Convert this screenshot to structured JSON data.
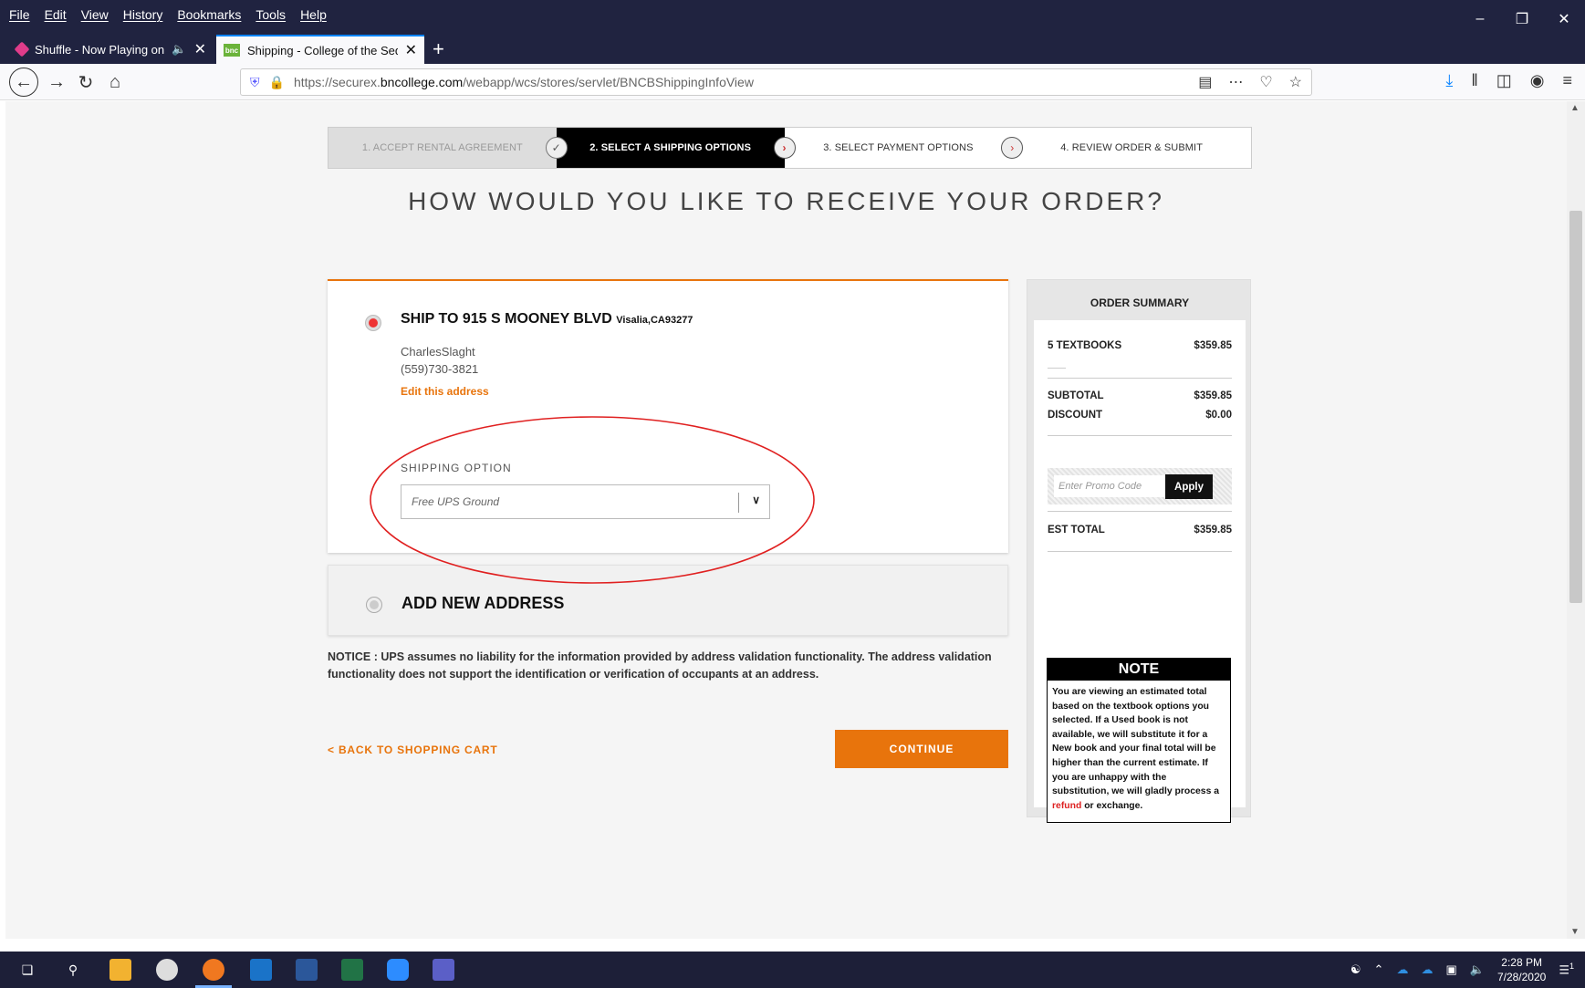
{
  "browser": {
    "menu": [
      "File",
      "Edit",
      "View",
      "History",
      "Bookmarks",
      "Tools",
      "Help"
    ],
    "tabs": [
      {
        "title": "Shuffle - Now Playing on Pa",
        "icon": "shuffle-favicon"
      },
      {
        "title": "Shipping - College of the Sequ",
        "icon": "bnc-favicon",
        "favicon_text": "bnc"
      }
    ],
    "url_prefix": "https://securex.",
    "url_domain": "bncollege.com",
    "url_path": "/webapp/wcs/stores/servlet/BNCBShippingInfoView"
  },
  "steps": [
    {
      "label": "1. ACCEPT RENTAL AGREEMENT",
      "state": "done"
    },
    {
      "label": "2. SELECT A SHIPPING OPTIONS",
      "state": "current"
    },
    {
      "label": "3. SELECT PAYMENT OPTIONS",
      "state": "todo"
    },
    {
      "label": "4. REVIEW ORDER & SUBMIT",
      "state": "todo"
    }
  ],
  "page_title": "HOW WOULD YOU LIKE TO RECEIVE YOUR ORDER?",
  "address": {
    "ship_to": "SHIP TO 915 S MOONEY BLVD",
    "city": "Visalia,CA93277",
    "name": "CharlesSlaght",
    "phone": "(559)730-3821",
    "edit_label": "Edit this address"
  },
  "shipping": {
    "label": "SHIPPING OPTION",
    "selected": "Free UPS Ground"
  },
  "new_address_label": "ADD NEW ADDRESS",
  "notice": "NOTICE : UPS assumes no liability for the information provided by address validation functionality. The address validation functionality does not support the identification or verification of occupants at an address.",
  "back_label": "< BACK TO SHOPPING CART",
  "continue_label": "CONTINUE",
  "summary": {
    "title": "ORDER SUMMARY",
    "items_label": "5 TEXTBOOKS",
    "items_value": "$359.85",
    "subtotal_label": "SUBTOTAL",
    "subtotal_value": "$359.85",
    "discount_label": "DISCOUNT",
    "discount_value": "$0.00",
    "promo_placeholder": "Enter Promo Code",
    "apply_label": "Apply",
    "total_label": "EST TOTAL",
    "total_value": "$359.85",
    "note_title": "NOTE",
    "note_text": "You are viewing an estimated total based on the textbook options you selected. If a Used book is not available, we will substitute it for a New book and your final total will be higher than the current estimate. If you are unhappy with the substitution, we will gladly process a",
    "note_link": "refund",
    "note_end": " or exchange."
  },
  "taskbar": {
    "time": "2:28 PM",
    "date": "7/28/2020",
    "notification_count": "1"
  },
  "colors": {
    "accent": "#e8740c",
    "highlight_ellipse": "#e02020",
    "titlebar": "#202340"
  }
}
